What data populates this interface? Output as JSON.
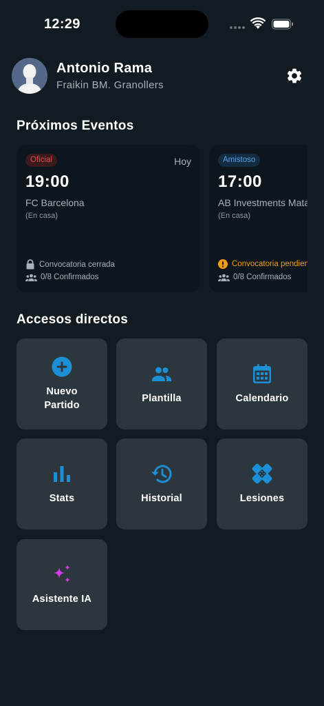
{
  "status_bar": {
    "time": "12:29"
  },
  "header": {
    "user_name": "Antonio Rama",
    "team_name": "Fraikin BM. Granollers"
  },
  "events_section": {
    "title": "Próximos Eventos",
    "events": [
      {
        "badge": "Oficial",
        "day": "Hoy",
        "time": "19:00",
        "opponent": "FC Barcelona",
        "venue": "(En casa)",
        "status": "Convocatoria cerrada",
        "confirmed": "0/8 Confirmados"
      },
      {
        "badge": "Amistoso",
        "day": "",
        "time": "17:00",
        "opponent": "AB Investments Mataró",
        "venue": "(En casa)",
        "status": "Convocatoria pendiente",
        "confirmed": "0/8 Confirmados"
      }
    ]
  },
  "shortcuts_section": {
    "title": "Accesos directos",
    "items": [
      {
        "label": "Nuevo Partido",
        "icon": "plus-circle-icon"
      },
      {
        "label": "Plantilla",
        "icon": "people-icon"
      },
      {
        "label": "Calendario",
        "icon": "calendar-icon"
      },
      {
        "label": "Stats",
        "icon": "bar-chart-icon"
      },
      {
        "label": "Historial",
        "icon": "history-icon"
      },
      {
        "label": "Lesiones",
        "icon": "bandage-icon"
      },
      {
        "label": "Asistente IA",
        "icon": "sparkles-icon"
      }
    ]
  },
  "colors": {
    "background": "#121b21",
    "card": "#2c363d",
    "event_card": "#0d161c",
    "accent_blue": "#1d8fd6",
    "badge_red": "#e04848",
    "badge_blue": "#4fa2e6",
    "warning_orange": "#f39c12",
    "ai_magenta": "#d63ae6"
  }
}
